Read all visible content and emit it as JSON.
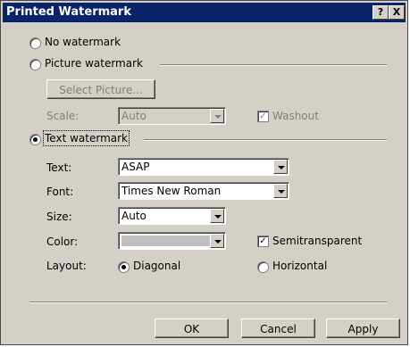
{
  "dialog": {
    "title": "Printed Watermark",
    "help_label": "?",
    "close_label": "X"
  },
  "options": {
    "no_watermark": "No watermark",
    "picture_watermark": "Picture watermark",
    "select_picture": "Select Picture...",
    "scale_label": "Scale:",
    "scale_value": "Auto",
    "washout": "Washout",
    "text_watermark": "Text watermark"
  },
  "text_settings": {
    "text_label": "Text:",
    "text_value": "ASAP",
    "font_label": "Font:",
    "font_value": "Times New Roman",
    "size_label": "Size:",
    "size_value": "Auto",
    "color_label": "Color:",
    "color_value": "#c0c0c0",
    "semitransparent": "Semitransparent",
    "layout_label": "Layout:",
    "diagonal": "Diagonal",
    "horizontal": "Horizontal"
  },
  "buttons": {
    "ok": "OK",
    "cancel": "Cancel",
    "apply": "Apply"
  }
}
